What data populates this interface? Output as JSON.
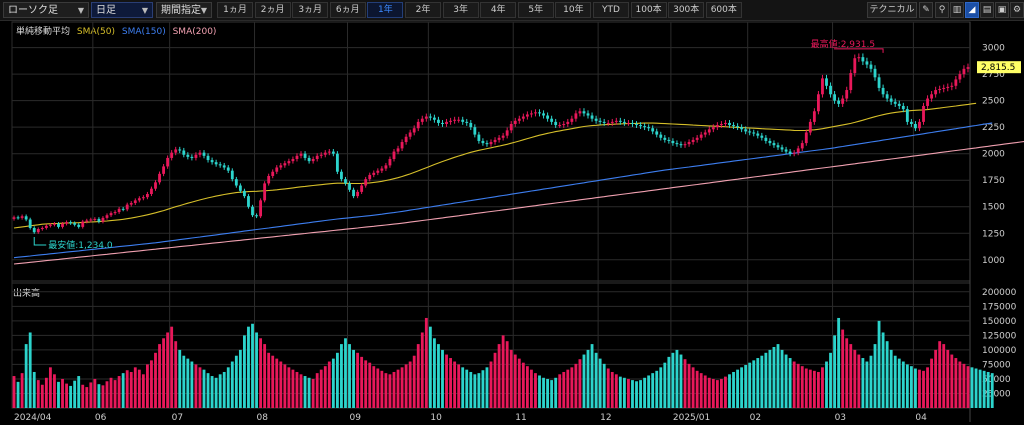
{
  "toolbar": {
    "chart_type": "ローソク足",
    "period": "日足",
    "range_mode": "期間指定",
    "ranges": [
      "1ヵ月",
      "2ヵ月",
      "3ヵ月",
      "6ヵ月",
      "1年",
      "2年",
      "3年",
      "4年",
      "5年",
      "10年",
      "YTD",
      "100本",
      "300本",
      "600本"
    ],
    "active_range": "1年",
    "technical": "テクニカル"
  },
  "legend": {
    "title": "単純移動平均",
    "sma50": "SMA(50)",
    "sma150": "SMA(150)",
    "sma200": "SMA(200)"
  },
  "colors": {
    "up": "#e8185a",
    "down": "#2cd4cc",
    "sma50": "#d6bf2a",
    "sma150": "#3d7ef0",
    "sma200": "#f0a0b0",
    "grid": "#2b2b2b"
  },
  "volume_title": "出来高",
  "chart_data": [
    {
      "type": "candlestick",
      "ylim": [
        800,
        3100
      ],
      "y_ticks": [
        1000,
        1250,
        1500,
        1750,
        2000,
        2250,
        2500,
        2750,
        3000
      ],
      "x_labels": [
        "2024/04",
        "06",
        "07",
        "08",
        "09",
        "10",
        "11",
        "12",
        "2025/01",
        "02",
        "03",
        "04"
      ],
      "x_label_bars": [
        0,
        20,
        39,
        60,
        83,
        103,
        124,
        145,
        163,
        182,
        203,
        223
      ],
      "last_price": "2,815.5",
      "high_annotation": {
        "text": "最高値:2,931.5",
        "bar": 214,
        "value": 2931.5
      },
      "low_annotation": {
        "text": "最安値:1,234.0",
        "bar": 5,
        "value": 1234.0
      },
      "close": [
        1400,
        1395,
        1410,
        1380,
        1300,
        1260,
        1290,
        1300,
        1320,
        1330,
        1340,
        1310,
        1340,
        1355,
        1345,
        1330,
        1310,
        1360,
        1370,
        1380,
        1385,
        1360,
        1395,
        1420,
        1440,
        1450,
        1480,
        1475,
        1520,
        1535,
        1560,
        1580,
        1590,
        1620,
        1670,
        1730,
        1810,
        1880,
        1960,
        2010,
        2040,
        2030,
        1990,
        1970,
        1960,
        1990,
        2010,
        1980,
        1940,
        1920,
        1900,
        1890,
        1870,
        1840,
        1760,
        1700,
        1650,
        1600,
        1500,
        1420,
        1410,
        1560,
        1720,
        1790,
        1830,
        1870,
        1890,
        1910,
        1930,
        1950,
        1980,
        2000,
        1960,
        1930,
        1950,
        1980,
        1990,
        2010,
        2020,
        2000,
        1830,
        1760,
        1720,
        1660,
        1600,
        1640,
        1700,
        1760,
        1800,
        1820,
        1840,
        1860,
        1890,
        1950,
        2020,
        2050,
        2110,
        2160,
        2200,
        2240,
        2300,
        2330,
        2350,
        2340,
        2320,
        2290,
        2280,
        2300,
        2310,
        2320,
        2320,
        2300,
        2290,
        2250,
        2180,
        2120,
        2100,
        2090,
        2110,
        2130,
        2150,
        2170,
        2220,
        2280,
        2310,
        2330,
        2350,
        2370,
        2380,
        2390,
        2380,
        2360,
        2330,
        2300,
        2270,
        2270,
        2280,
        2300,
        2330,
        2380,
        2400,
        2380,
        2360,
        2330,
        2310,
        2300,
        2290,
        2290,
        2300,
        2310,
        2300,
        2290,
        2290,
        2280,
        2270,
        2260,
        2250,
        2240,
        2210,
        2180,
        2150,
        2130,
        2120,
        2100,
        2090,
        2080,
        2090,
        2110,
        2130,
        2150,
        2180,
        2200,
        2230,
        2250,
        2270,
        2280,
        2290,
        2270,
        2260,
        2250,
        2230,
        2210,
        2200,
        2190,
        2170,
        2150,
        2120,
        2100,
        2080,
        2060,
        2040,
        2020,
        2000,
        2010,
        2050,
        2100,
        2200,
        2300,
        2400,
        2560,
        2710,
        2640,
        2560,
        2500,
        2470,
        2520,
        2600,
        2760,
        2900,
        2910,
        2870,
        2840,
        2800,
        2720,
        2620,
        2560,
        2520,
        2490,
        2470,
        2450,
        2420,
        2300,
        2280,
        2240,
        2300,
        2450,
        2520,
        2560,
        2600,
        2610,
        2620,
        2630,
        2640,
        2700,
        2750,
        2800,
        2815.5
      ],
      "sma50": [
        1300,
        1305,
        1310,
        1315,
        1320,
        1325,
        1330,
        1335,
        1338,
        1340,
        1342,
        1343,
        1345,
        1347,
        1348,
        1349,
        1350,
        1352,
        1354,
        1356,
        1358,
        1360,
        1363,
        1366,
        1369,
        1373,
        1377,
        1382,
        1387,
        1393,
        1400,
        1408,
        1416,
        1424,
        1433,
        1443,
        1453,
        1464,
        1476,
        1488,
        1500,
        1511,
        1522,
        1533,
        1544,
        1554,
        1564,
        1574,
        1583,
        1592,
        1600,
        1608,
        1615,
        1622,
        1628,
        1633,
        1637,
        1640,
        1643,
        1645,
        1646,
        1648,
        1650,
        1653,
        1656,
        1660,
        1664,
        1668,
        1673,
        1678,
        1683,
        1688,
        1692,
        1696,
        1700,
        1704,
        1708,
        1712,
        1716,
        1720,
        1722,
        1722,
        1721,
        1720,
        1719,
        1719,
        1720,
        1722,
        1725,
        1729,
        1734,
        1740,
        1747,
        1755,
        1764,
        1774,
        1785,
        1797,
        1810,
        1824,
        1838,
        1853,
        1868,
        1883,
        1898,
        1912,
        1926,
        1940,
        1953,
        1966,
        1978,
        1990,
        2002,
        2013,
        2023,
        2032,
        2040,
        2048,
        2056,
        2064,
        2072,
        2080,
        2089,
        2099,
        2109,
        2120,
        2131,
        2142,
        2153,
        2164,
        2174,
        2183,
        2192,
        2200,
        2208,
        2215,
        2222,
        2229,
        2236,
        2243,
        2250,
        2256,
        2261,
        2265,
        2268,
        2271,
        2273,
        2275,
        2277,
        2279,
        2281,
        2283,
        2284,
        2285,
        2286,
        2287,
        2288,
        2288,
        2288,
        2287,
        2286,
        2284,
        2282,
        2280,
        2278,
        2276,
        2274,
        2272,
        2270,
        2268,
        2266,
        2264,
        2262,
        2260,
        2258,
        2256,
        2254,
        2252,
        2250,
        2248,
        2246,
        2244,
        2242,
        2240,
        2238,
        2236,
        2234,
        2232,
        2230,
        2228,
        2226,
        2224,
        2222,
        2220,
        2219,
        2219,
        2220,
        2222,
        2225,
        2230,
        2236,
        2243,
        2250,
        2257,
        2264,
        2271,
        2278,
        2286,
        2295,
        2305,
        2316,
        2327,
        2338,
        2349,
        2359,
        2368,
        2376,
        2383,
        2389,
        2394,
        2399,
        2403,
        2406,
        2409,
        2411,
        2413,
        2416,
        2420,
        2425,
        2430,
        2435,
        2440,
        2445,
        2450,
        2455,
        2460,
        2465,
        2470,
        2475
      ],
      "sma150": [
        1020,
        1024,
        1028,
        1032,
        1036,
        1040,
        1044,
        1048,
        1052,
        1056,
        1060,
        1064,
        1068,
        1072,
        1076,
        1080,
        1084,
        1088,
        1092,
        1096,
        1100,
        1104,
        1108,
        1112,
        1116,
        1120,
        1124,
        1128,
        1132,
        1136,
        1140,
        1144,
        1148,
        1152,
        1156,
        1160,
        1165,
        1170,
        1175,
        1180,
        1185,
        1190,
        1195,
        1200,
        1205,
        1210,
        1215,
        1220,
        1225,
        1230,
        1235,
        1240,
        1245,
        1250,
        1255,
        1260,
        1265,
        1270,
        1275,
        1280,
        1285,
        1290,
        1295,
        1300,
        1305,
        1310,
        1315,
        1320,
        1325,
        1330,
        1335,
        1340,
        1345,
        1350,
        1355,
        1360,
        1365,
        1370,
        1375,
        1380,
        1384,
        1388,
        1392,
        1396,
        1400,
        1404,
        1408,
        1412,
        1416,
        1420,
        1425,
        1430,
        1435,
        1440,
        1445,
        1450,
        1456,
        1462,
        1468,
        1474,
        1480,
        1486,
        1492,
        1498,
        1504,
        1510,
        1516,
        1522,
        1528,
        1534,
        1540,
        1546,
        1552,
        1558,
        1564,
        1570,
        1576,
        1582,
        1588,
        1594,
        1600,
        1606,
        1612,
        1618,
        1624,
        1630,
        1636,
        1642,
        1648,
        1654,
        1660,
        1666,
        1672,
        1678,
        1684,
        1690,
        1696,
        1702,
        1708,
        1714,
        1720,
        1726,
        1732,
        1738,
        1744,
        1750,
        1756,
        1762,
        1768,
        1774,
        1780,
        1786,
        1792,
        1798,
        1804,
        1810,
        1816,
        1822,
        1828,
        1834,
        1840,
        1845,
        1850,
        1855,
        1860,
        1865,
        1870,
        1875,
        1880,
        1885,
        1890,
        1895,
        1900,
        1905,
        1910,
        1915,
        1920,
        1925,
        1930,
        1935,
        1940,
        1945,
        1950,
        1955,
        1960,
        1965,
        1970,
        1975,
        1980,
        1985,
        1990,
        1995,
        2000,
        2005,
        2010,
        2015,
        2020,
        2025,
        2030,
        2035,
        2040,
        2045,
        2050,
        2056,
        2062,
        2068,
        2074,
        2080,
        2086,
        2092,
        2098,
        2104,
        2110,
        2116,
        2122,
        2128,
        2134,
        2140,
        2146,
        2152,
        2158,
        2164,
        2170,
        2176,
        2182,
        2188,
        2194,
        2200,
        2206,
        2212,
        2218,
        2224,
        2230,
        2236,
        2242,
        2248,
        2254,
        2260,
        2266,
        2272,
        2278,
        2284,
        2290
      ],
      "sma200": [
        960,
        964,
        968,
        972,
        976,
        980,
        984,
        988,
        992,
        996,
        1000,
        1004,
        1008,
        1012,
        1016,
        1020,
        1024,
        1028,
        1032,
        1036,
        1040,
        1044,
        1048,
        1052,
        1056,
        1060,
        1064,
        1068,
        1072,
        1076,
        1080,
        1084,
        1088,
        1092,
        1096,
        1100,
        1104,
        1108,
        1112,
        1116,
        1120,
        1124,
        1128,
        1132,
        1136,
        1140,
        1144,
        1148,
        1152,
        1156,
        1160,
        1164,
        1168,
        1172,
        1176,
        1180,
        1184,
        1188,
        1192,
        1196,
        1200,
        1204,
        1208,
        1212,
        1216,
        1220,
        1224,
        1228,
        1232,
        1236,
        1240,
        1244,
        1248,
        1252,
        1256,
        1260,
        1264,
        1268,
        1272,
        1276,
        1280,
        1284,
        1288,
        1292,
        1296,
        1300,
        1304,
        1308,
        1312,
        1316,
        1320,
        1324,
        1328,
        1332,
        1336,
        1340,
        1345,
        1350,
        1355,
        1360,
        1365,
        1370,
        1375,
        1380,
        1385,
        1390,
        1395,
        1400,
        1405,
        1410,
        1415,
        1420,
        1425,
        1430,
        1435,
        1440,
        1445,
        1450,
        1455,
        1460,
        1465,
        1470,
        1475,
        1480,
        1485,
        1490,
        1495,
        1500,
        1505,
        1510,
        1515,
        1520,
        1525,
        1530,
        1535,
        1540,
        1545,
        1550,
        1555,
        1560,
        1565,
        1570,
        1575,
        1580,
        1585,
        1590,
        1595,
        1600,
        1605,
        1610,
        1615,
        1620,
        1625,
        1630,
        1635,
        1640,
        1645,
        1650,
        1655,
        1660,
        1665,
        1670,
        1675,
        1680,
        1685,
        1690,
        1695,
        1700,
        1705,
        1710,
        1715,
        1720,
        1725,
        1730,
        1735,
        1740,
        1745,
        1750,
        1755,
        1760,
        1765,
        1770,
        1775,
        1780,
        1785,
        1790,
        1795,
        1800,
        1805,
        1810,
        1815,
        1820,
        1825,
        1830,
        1835,
        1840,
        1845,
        1850,
        1855,
        1860,
        1865,
        1870,
        1875,
        1880,
        1885,
        1890,
        1895,
        1900,
        1905,
        1910,
        1915,
        1920,
        1925,
        1930,
        1935,
        1940,
        1945,
        1950,
        1955,
        1960,
        1965,
        1970,
        1975,
        1980,
        1985,
        1990,
        1995,
        2000,
        2005,
        2010,
        2015,
        2020,
        2025,
        2030,
        2035,
        2040,
        2045,
        2050,
        2055,
        2060,
        2065,
        2070,
        2075,
        2080,
        2085,
        2090,
        2095,
        2100,
        2105,
        2110,
        2115,
        2120,
        2125,
        2130,
        2135,
        2140,
        2145,
        2150,
        2155,
        2160,
        2165,
        2170
      ]
    },
    {
      "type": "bar",
      "ylim": [
        0,
        210000
      ],
      "y_ticks": [
        25000,
        50000,
        75000,
        100000,
        125000,
        150000,
        175000,
        200000
      ],
      "volume": [
        55000,
        45000,
        60000,
        110000,
        130000,
        62000,
        48000,
        40000,
        52000,
        70000,
        58000,
        45000,
        50000,
        42000,
        38000,
        47000,
        55000,
        40000,
        36000,
        44000,
        50000,
        41000,
        39000,
        46000,
        52000,
        48000,
        55000,
        60000,
        65000,
        62000,
        70000,
        66000,
        58000,
        75000,
        82000,
        95000,
        110000,
        120000,
        130000,
        140000,
        115000,
        100000,
        90000,
        85000,
        80000,
        75000,
        70000,
        66000,
        60000,
        55000,
        52000,
        58000,
        62000,
        70000,
        80000,
        90000,
        100000,
        125000,
        140000,
        145000,
        130000,
        120000,
        110000,
        95000,
        90000,
        85000,
        80000,
        75000,
        70000,
        66000,
        62000,
        58000,
        55000,
        52000,
        50000,
        60000,
        66000,
        72000,
        80000,
        85000,
        95000,
        110000,
        120000,
        110000,
        100000,
        95000,
        88000,
        82000,
        78000,
        72000,
        68000,
        64000,
        60000,
        58000,
        62000,
        66000,
        70000,
        75000,
        80000,
        90000,
        110000,
        130000,
        155000,
        140000,
        120000,
        110000,
        100000,
        92000,
        86000,
        80000,
        75000,
        70000,
        66000,
        62000,
        58000,
        60000,
        65000,
        70000,
        80000,
        95000,
        110000,
        125000,
        115000,
        100000,
        92000,
        85000,
        78000,
        72000,
        66000,
        60000,
        56000,
        52000,
        50000,
        48000,
        52000,
        58000,
        62000,
        66000,
        70000,
        76000,
        84000,
        92000,
        100000,
        110000,
        95000,
        85000,
        76000,
        68000,
        62000,
        58000,
        54000,
        52000,
        50000,
        48000,
        46000,
        48000,
        52000,
        56000,
        60000,
        64000,
        70000,
        78000,
        88000,
        95000,
        100000,
        92000,
        84000,
        76000,
        70000,
        64000,
        60000,
        56000,
        52000,
        50000,
        48000,
        50000,
        54000,
        58000,
        62000,
        66000,
        70000,
        74000,
        78000,
        82000,
        86000,
        90000,
        95000,
        100000,
        105000,
        110000,
        100000,
        92000,
        86000,
        80000,
        76000,
        72000,
        68000,
        66000,
        64000,
        62000,
        70000,
        80000,
        95000,
        125000,
        155000,
        135000,
        120000,
        110000,
        100000,
        92000,
        86000,
        80000,
        90000,
        110000,
        150000,
        130000,
        115000,
        100000,
        90000,
        85000,
        80000,
        75000,
        72000,
        68000,
        66000,
        64000,
        70000,
        85000,
        100000,
        115000,
        110000,
        100000,
        92000,
        86000,
        80000,
        76000,
        72000,
        70000,
        68000,
        66000,
        64000,
        62000,
        60000
      ]
    }
  ]
}
